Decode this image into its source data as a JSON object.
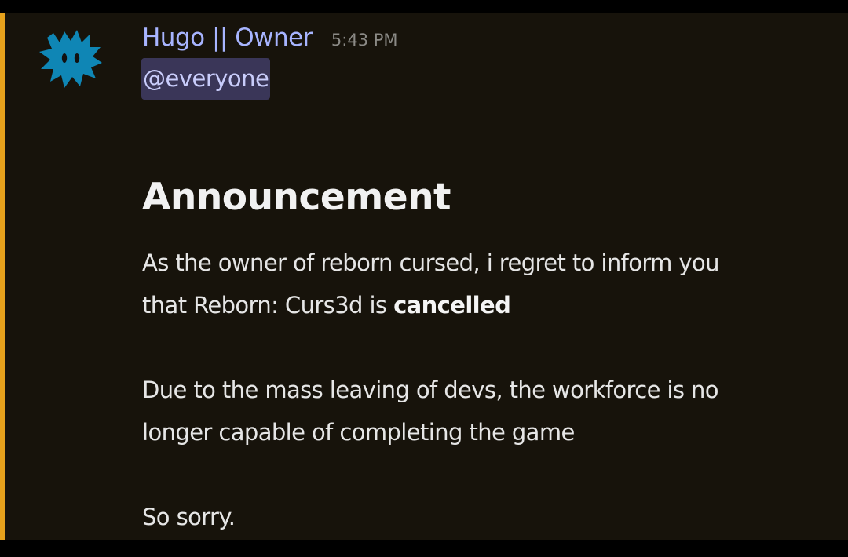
{
  "message": {
    "author": "Hugo || Owner",
    "timestamp": "5:43 PM",
    "mention": "@everyone",
    "heading": "Announcement",
    "paragraph1_line1": "As the owner of reborn cursed, i regret to inform you",
    "paragraph1_line2_prefix": "that Reborn: Curs3d is ",
    "paragraph1_line2_bold": "cancelled",
    "paragraph2_line1": "Due to the mass leaving of devs, the workforce is no",
    "paragraph2_line2": "longer capable of completing the game",
    "paragraph3": "So sorry."
  },
  "colors": {
    "background": "#17130b",
    "highlight_bar": "#e6a11c",
    "username": "#a7b4ff",
    "mention_bg": "#3a3658",
    "avatar": "#0f86b5"
  },
  "icons": {
    "avatar": "spiky-blue-creature-avatar"
  }
}
